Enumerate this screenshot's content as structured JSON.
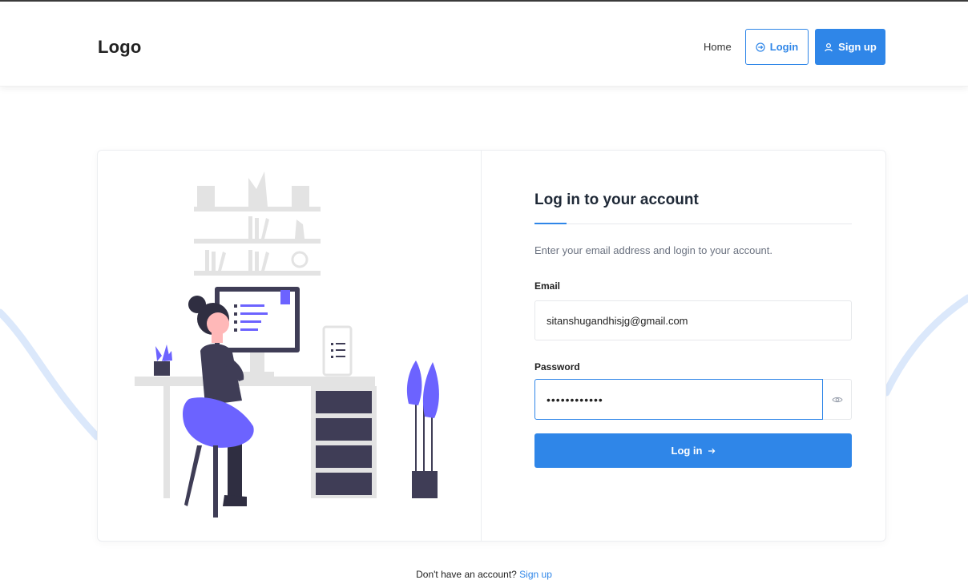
{
  "nav": {
    "logo": "Logo",
    "home": "Home",
    "login": "Login",
    "signup": "Sign up"
  },
  "form": {
    "title": "Log in to your account",
    "subtitle": "Enter your email address and login to your account.",
    "email_label": "Email",
    "email_value": "sitanshugandhisjg@gmail.com",
    "password_label": "Password",
    "password_value": "••••••••••••",
    "submit_label": "Log in"
  },
  "footer": {
    "prompt": "Don't have an account?",
    "signup_link": "Sign up"
  },
  "colors": {
    "accent": "#2f86e8",
    "illustration_purple": "#6c63ff",
    "illustration_dark": "#3f3d56"
  },
  "icons": {
    "login": "login-arrow-icon",
    "signup": "user-icon",
    "password_toggle": "eye-icon",
    "submit": "arrow-right-icon"
  }
}
